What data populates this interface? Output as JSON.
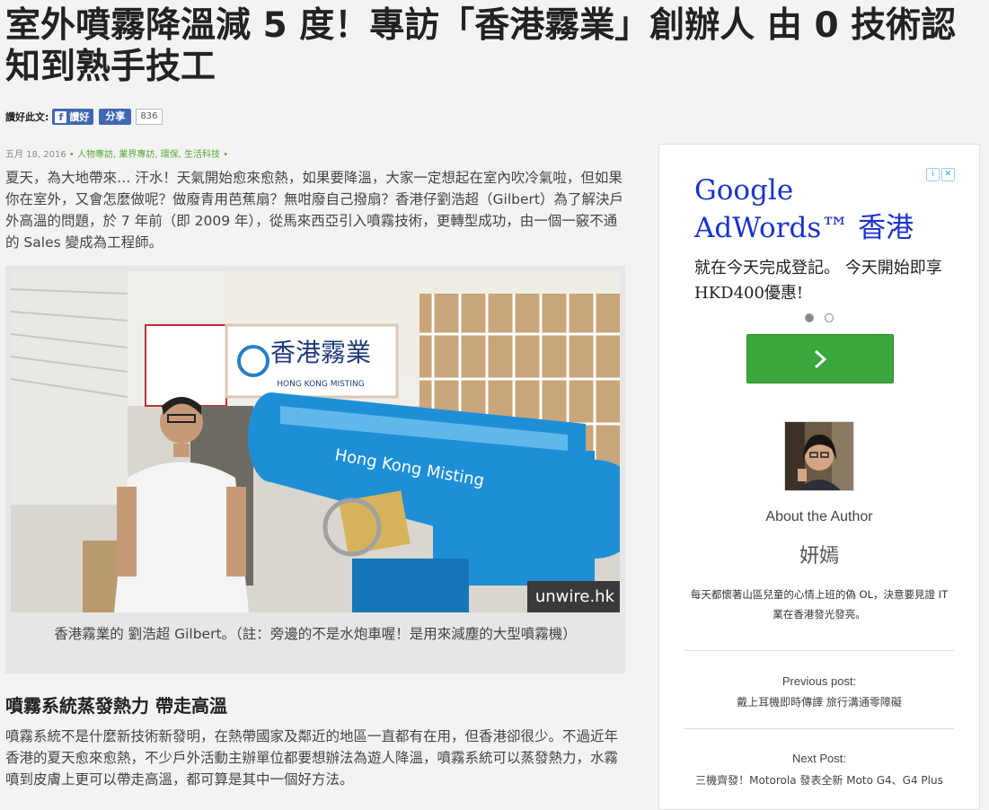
{
  "article": {
    "title": "室外噴霧降溫減 5 度！專訪「香港霧業」創辦人 由 0 技術認知到熟手技工",
    "share": {
      "label": "讚好此文:",
      "like_label": "讚好",
      "share_label": "分享",
      "count": "836"
    },
    "meta": {
      "date": "五月 18, 2016",
      "categories": [
        "人物專訪",
        "業界專訪",
        "環保",
        "生活科技"
      ]
    },
    "intro": "夏天，為大地帶來… 汗水！天氣開始愈來愈熱，如果要降溫，大家一定想起在室內吹冷氣啦，但如果你在室外，又會怎麼做呢？做廢青用芭蕉扇？無咁廢自己撥扇？香港仔劉浩超（Gilbert）為了解決戶外高溫的問題，於 7 年前（即 2009 年），從馬來西亞引入噴霧技術，更轉型成功，由一個一竅不通的 Sales 變成為工程師。",
    "figure": {
      "sign_text": "香港霧業",
      "sign_sub": "HONG KONG MISTING",
      "cannon_text": "Hong Kong Misting",
      "watermark": "unwire.hk",
      "caption": "香港霧業的 劉浩超 Gilbert。（註：旁邊的不是水炮車喔！是用來減塵的大型噴霧機）"
    },
    "section_heading": "噴霧系統蒸發熱力 帶走高溫",
    "section_body": "噴霧系統不是什麼新技術新發明，在熱帶國家及鄰近的地區一直都有在用，但香港卻很少。不過近年香港的夏天愈來愈熱，不少戶外活動主辦單位都要想辦法為遊人降溫，噴霧系統可以蒸發熱力，水霧噴到皮膚上更可以帶走高溫，都可算是其中一個好方法。"
  },
  "sidebar": {
    "ad": {
      "headline": "Google AdWords™ 香港",
      "body": "就在今天完成登記。 今天開始即享 HKD400優惠!",
      "info_icon": "info-icon",
      "close_icon": "close-icon",
      "cta_icon": "chevron-right-icon"
    },
    "author": {
      "about_label": "About the Author",
      "name": "妍嫣",
      "bio": "每天都懷著山區兒童的心情上班的偽 OL，決意要見證 IT 業在香港發光發亮。"
    },
    "previous_post": {
      "label": "Previous post:",
      "title": "戴上耳機即時傳譯 旅行溝通零障礙"
    },
    "next_post": {
      "label": "Next Post:",
      "title": "三機齊發！Motorola 發表全新 Moto G4、G4 Plus"
    }
  },
  "colors": {
    "facebook_blue": "#4267b2",
    "category_green": "#5aa836",
    "ad_link_blue": "#1a33cc",
    "ad_button_green": "#3ba63b",
    "cannon_blue": "#1e8fd6"
  }
}
